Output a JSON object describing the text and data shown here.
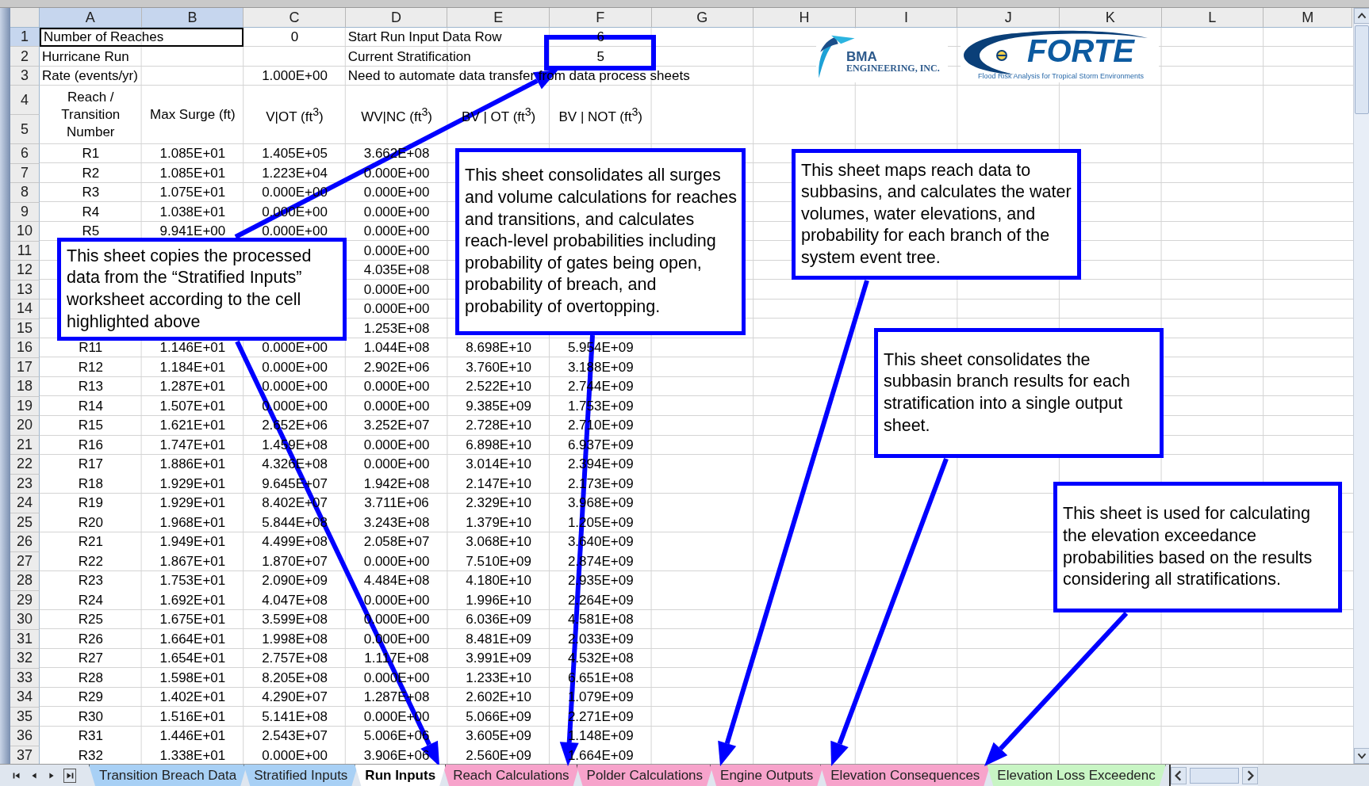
{
  "columns": [
    {
      "letter": "A",
      "selected": true
    },
    {
      "letter": "B",
      "selected": true
    },
    {
      "letter": "C",
      "selected": false
    },
    {
      "letter": "D",
      "selected": false
    },
    {
      "letter": "E",
      "selected": false
    },
    {
      "letter": "F",
      "selected": false
    },
    {
      "letter": "G",
      "selected": false
    },
    {
      "letter": "H",
      "selected": false
    },
    {
      "letter": "I",
      "selected": false
    },
    {
      "letter": "J",
      "selected": false
    },
    {
      "letter": "K",
      "selected": false
    },
    {
      "letter": "L",
      "selected": false
    },
    {
      "letter": "M",
      "selected": false
    }
  ],
  "rows": [
    {
      "number": "1",
      "selected": true,
      "cells": [
        "Number of Reaches",
        null,
        "0",
        "Start Run Input Data Row",
        null,
        "6"
      ]
    },
    {
      "number": "2",
      "selected": false,
      "cells": [
        "Hurricane Run",
        null,
        null,
        "Current Stratification",
        null,
        "5"
      ]
    },
    {
      "number": "3",
      "selected": false,
      "cells": [
        "Rate (events/yr)",
        null,
        "1.000E+00",
        "Need to automate data transfer from data process sheets",
        null,
        null
      ]
    }
  ],
  "header_rows": {
    "numbers": [
      "4",
      "5"
    ],
    "cells": [
      "Reach / Transition Number",
      "Max Surge (ft)",
      "V|OT (ft$^{3}$)",
      "WV|NC (ft$^{3}$)",
      "BV | OT (ft$^{3}$)",
      "BV | NOT (ft$^{3}$)"
    ]
  },
  "data_rows": [
    {
      "number": "6",
      "cells": [
        "R1",
        "1.085E+01",
        "1.405E+05",
        "3.662E+08",
        null,
        null
      ]
    },
    {
      "number": "7",
      "cells": [
        "R2",
        "1.085E+01",
        "1.223E+04",
        "0.000E+00",
        null,
        null
      ]
    },
    {
      "number": "8",
      "cells": [
        "R3",
        "1.075E+01",
        "0.000E+00",
        "0.000E+00",
        null,
        null
      ]
    },
    {
      "number": "9",
      "cells": [
        "R4",
        "1.038E+01",
        "0.000E+00",
        "0.000E+00",
        null,
        null
      ]
    },
    {
      "number": "10",
      "cells": [
        "R5",
        "9.941E+00",
        "0.000E+00",
        "0.000E+00",
        null,
        null
      ]
    },
    {
      "number": "11",
      "cells": [
        null,
        null,
        null,
        "0.000E+00",
        null,
        null
      ]
    },
    {
      "number": "12",
      "cells": [
        null,
        null,
        null,
        "4.035E+08",
        null,
        null
      ]
    },
    {
      "number": "13",
      "cells": [
        null,
        null,
        null,
        "0.000E+00",
        null,
        null
      ]
    },
    {
      "number": "14",
      "cells": [
        null,
        null,
        null,
        "0.000E+00",
        null,
        null
      ]
    },
    {
      "number": "15",
      "cells": [
        null,
        null,
        null,
        "1.253E+08",
        null,
        null
      ]
    },
    {
      "number": "16",
      "cells": [
        "R11",
        "1.146E+01",
        "0.000E+00",
        "1.044E+08",
        "8.698E+10",
        "5.954E+09"
      ]
    },
    {
      "number": "17",
      "cells": [
        "R12",
        "1.184E+01",
        "0.000E+00",
        "2.902E+06",
        "3.760E+10",
        "3.188E+09"
      ]
    },
    {
      "number": "18",
      "cells": [
        "R13",
        "1.287E+01",
        "0.000E+00",
        "0.000E+00",
        "2.522E+10",
        "2.744E+09"
      ]
    },
    {
      "number": "19",
      "cells": [
        "R14",
        "1.507E+01",
        "0.000E+00",
        "0.000E+00",
        "9.385E+09",
        "1.753E+09"
      ]
    },
    {
      "number": "20",
      "cells": [
        "R15",
        "1.621E+01",
        "2.652E+06",
        "3.252E+07",
        "2.728E+10",
        "2.710E+09"
      ]
    },
    {
      "number": "21",
      "cells": [
        "R16",
        "1.747E+01",
        "1.459E+08",
        "0.000E+00",
        "6.898E+10",
        "6.937E+09"
      ]
    },
    {
      "number": "22",
      "cells": [
        "R17",
        "1.886E+01",
        "4.326E+08",
        "0.000E+00",
        "3.014E+10",
        "2.394E+09"
      ]
    },
    {
      "number": "23",
      "cells": [
        "R18",
        "1.929E+01",
        "9.645E+07",
        "1.942E+08",
        "2.147E+10",
        "2.173E+09"
      ]
    },
    {
      "number": "24",
      "cells": [
        "R19",
        "1.929E+01",
        "8.402E+07",
        "3.711E+06",
        "2.329E+10",
        "3.968E+09"
      ]
    },
    {
      "number": "25",
      "cells": [
        "R20",
        "1.968E+01",
        "5.844E+08",
        "3.243E+08",
        "1.379E+10",
        "1.205E+09"
      ]
    },
    {
      "number": "26",
      "cells": [
        "R21",
        "1.949E+01",
        "4.499E+08",
        "2.058E+07",
        "3.068E+10",
        "3.640E+09"
      ]
    },
    {
      "number": "27",
      "cells": [
        "R22",
        "1.867E+01",
        "1.870E+07",
        "0.000E+00",
        "7.510E+09",
        "2.874E+09"
      ]
    },
    {
      "number": "28",
      "cells": [
        "R23",
        "1.753E+01",
        "2.090E+09",
        "4.484E+08",
        "4.180E+10",
        "2.935E+09"
      ]
    },
    {
      "number": "29",
      "cells": [
        "R24",
        "1.692E+01",
        "4.047E+08",
        "0.000E+00",
        "1.996E+10",
        "2.264E+09"
      ]
    },
    {
      "number": "30",
      "cells": [
        "R25",
        "1.675E+01",
        "3.599E+08",
        "0.000E+00",
        "6.036E+09",
        "4.581E+08"
      ]
    },
    {
      "number": "31",
      "cells": [
        "R26",
        "1.664E+01",
        "1.998E+08",
        "0.000E+00",
        "8.481E+09",
        "2.033E+09"
      ]
    },
    {
      "number": "32",
      "cells": [
        "R27",
        "1.654E+01",
        "2.757E+08",
        "1.117E+08",
        "3.991E+09",
        "4.532E+08"
      ]
    },
    {
      "number": "33",
      "cells": [
        "R28",
        "1.598E+01",
        "8.205E+08",
        "0.000E+00",
        "1.233E+10",
        "6.651E+08"
      ]
    },
    {
      "number": "34",
      "cells": [
        "R29",
        "1.402E+01",
        "4.290E+07",
        "1.287E+08",
        "2.602E+10",
        "1.079E+09"
      ]
    },
    {
      "number": "35",
      "cells": [
        "R30",
        "1.516E+01",
        "5.141E+08",
        "0.000E+00",
        "5.066E+09",
        "2.271E+09"
      ]
    },
    {
      "number": "36",
      "cells": [
        "R31",
        "1.446E+01",
        "2.543E+07",
        "5.006E+06",
        "3.605E+09",
        "1.148E+09"
      ]
    },
    {
      "number": "37",
      "cells": [
        "R32",
        "1.338E+01",
        "0.000E+00",
        "3.906E+06",
        "2.560E+09",
        "1.664E+09"
      ]
    }
  ],
  "logos": {
    "bma": {
      "name": "BMA",
      "subtitle": "ENGINEERING, INC."
    },
    "forte": {
      "name": "FORTE",
      "tagline": "Flood Risk Analysis for Tropical Storm Environments"
    }
  },
  "callouts": [
    "This sheet copies the processed data from the “Stratified Inputs” worksheet according to the cell highlighted above",
    "This sheet consolidates all surges and volume calculations for reaches and transitions, and calculates reach-level probabilities including probability of gates being open, probability of breach, and probability of overtopping.",
    "This sheet maps reach data to subbasins, and calculates the water volumes, water elevations, and probability for each branch of the system event tree.",
    "This sheet consolidates the subbasin branch results for each stratification into a single output sheet.",
    "This sheet is used for calculating the elevation exceedance probabilities based on the results considering all stratifications."
  ],
  "sheet_tabs": [
    {
      "label": "Transition Breach Data",
      "selected": false,
      "color": "#a8d0f5"
    },
    {
      "label": "Stratified Inputs",
      "selected": false,
      "color": "#a8d0f5"
    },
    {
      "label": "Run Inputs",
      "selected": true
    },
    {
      "label": "Reach Calculations",
      "selected": false,
      "color": "#f7a3cb"
    },
    {
      "label": "Polder Calculations",
      "selected": false,
      "color": "#f7a3cb"
    },
    {
      "label": "Engine Outputs",
      "selected": false,
      "color": "#f7a3cb"
    },
    {
      "label": "Elevation Consequences",
      "selected": false,
      "color": "#f7a3cb"
    },
    {
      "label": "Elevation Loss Exceedenc",
      "selected": false,
      "color": "#c8f5c4"
    }
  ]
}
